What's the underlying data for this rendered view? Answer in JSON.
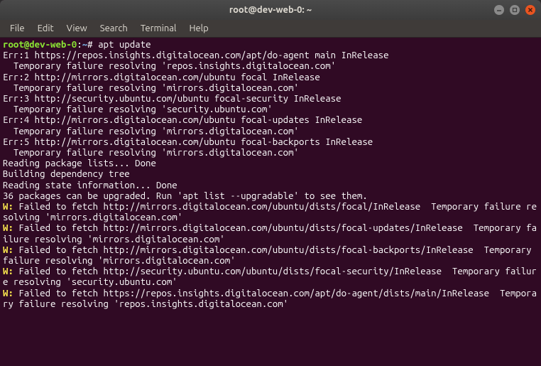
{
  "window": {
    "title": "root@dev-web-0: ~"
  },
  "menubar": {
    "items": [
      "File",
      "Edit",
      "View",
      "Search",
      "Terminal",
      "Help"
    ]
  },
  "prompt": {
    "user_host": "root@dev-web-0",
    "colon": ":",
    "path": "~",
    "hash": "#",
    "command": "apt update"
  },
  "output": {
    "lines": [
      "Err:1 https://repos.insights.digitalocean.com/apt/do-agent main InRelease",
      "  Temporary failure resolving 'repos.insights.digitalocean.com'",
      "Err:2 http://mirrors.digitalocean.com/ubuntu focal InRelease",
      "  Temporary failure resolving 'mirrors.digitalocean.com'",
      "Err:3 http://security.ubuntu.com/ubuntu focal-security InRelease",
      "  Temporary failure resolving 'security.ubuntu.com'",
      "Err:4 http://mirrors.digitalocean.com/ubuntu focal-updates InRelease",
      "  Temporary failure resolving 'mirrors.digitalocean.com'",
      "Err:5 http://mirrors.digitalocean.com/ubuntu focal-backports InRelease",
      "  Temporary failure resolving 'mirrors.digitalocean.com'",
      "Reading package lists... Done",
      "Building dependency tree",
      "Reading state information... Done",
      "36 packages can be upgraded. Run 'apt list --upgradable' to see them."
    ],
    "warnings": [
      {
        "prefix": "W: ",
        "text": "Failed to fetch http://mirrors.digitalocean.com/ubuntu/dists/focal/InRelease  Temporary failure resolving 'mirrors.digitalocean.com'"
      },
      {
        "prefix": "W: ",
        "text": "Failed to fetch http://mirrors.digitalocean.com/ubuntu/dists/focal-updates/InRelease  Temporary failure resolving 'mirrors.digitalocean.com'"
      },
      {
        "prefix": "W: ",
        "text": "Failed to fetch http://mirrors.digitalocean.com/ubuntu/dists/focal-backports/InRelease  Temporary failure resolving 'mirrors.digitalocean.com'"
      },
      {
        "prefix": "W: ",
        "text": "Failed to fetch http://security.ubuntu.com/ubuntu/dists/focal-security/InRelease  Temporary failure resolving 'security.ubuntu.com'"
      },
      {
        "prefix": "W: ",
        "text": "Failed to fetch https://repos.insights.digitalocean.com/apt/do-agent/dists/main/InRelease  Temporary failure resolving 'repos.insights.digitalocean.com'"
      }
    ]
  }
}
